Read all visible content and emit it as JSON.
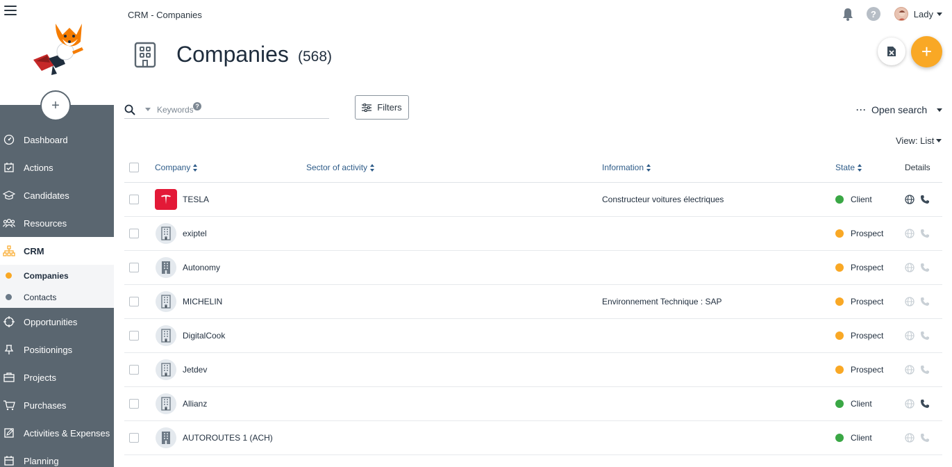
{
  "app": {
    "breadcrumb": "CRM - Companies",
    "user_name": "Lady",
    "help_label": "?"
  },
  "sidebar": {
    "add_label": "+",
    "items": [
      {
        "id": "dashboard",
        "label": "Dashboard",
        "icon": "gauge-icon"
      },
      {
        "id": "actions",
        "label": "Actions",
        "icon": "calendar-check-icon"
      },
      {
        "id": "candidates",
        "label": "Candidates",
        "icon": "graduation-cap-icon"
      },
      {
        "id": "resources",
        "label": "Resources",
        "icon": "users-icon"
      },
      {
        "id": "crm",
        "label": "CRM",
        "icon": "org-chart-icon",
        "active": true
      },
      {
        "id": "opportunities",
        "label": "Opportunities",
        "icon": "crosshair-icon"
      },
      {
        "id": "positionings",
        "label": "Positionings",
        "icon": "pin-icon"
      },
      {
        "id": "projects",
        "label": "Projects",
        "icon": "briefcase-icon"
      },
      {
        "id": "purchases",
        "label": "Purchases",
        "icon": "cart-icon"
      },
      {
        "id": "activities",
        "label": "Activities & Expenses",
        "icon": "edit-icon"
      },
      {
        "id": "planning",
        "label": "Planning",
        "icon": "calendar-icon"
      }
    ],
    "crm_sub": [
      {
        "label": "Companies",
        "active": true,
        "color": "#f9a825"
      },
      {
        "label": "Contacts",
        "active": false,
        "color": "#6b7a88"
      }
    ]
  },
  "page": {
    "title": "Companies",
    "count": "(568)",
    "add_label": "+"
  },
  "search": {
    "placeholder": "Keywords",
    "help": "?",
    "filters_label": "Filters",
    "open_search_label": "Open search",
    "view_label": "View: List"
  },
  "table": {
    "headers": {
      "company": "Company",
      "sector": "Sector of activity",
      "information": "Information",
      "state": "State",
      "details": "Details"
    },
    "rows": [
      {
        "name": "TESLA",
        "sector": "",
        "information": "Constructeur voitures électriques",
        "state": "Client",
        "state_color": "#3aa745",
        "logo": "tesla",
        "web_active": true,
        "phone_active": true
      },
      {
        "name": "exiptel",
        "sector": "",
        "information": "",
        "state": "Prospect",
        "state_color": "#f9a825",
        "logo": "building-outline",
        "web_active": false,
        "phone_active": false
      },
      {
        "name": "Autonomy",
        "sector": "",
        "information": "",
        "state": "Prospect",
        "state_color": "#f9a825",
        "logo": "building-solid",
        "web_active": false,
        "phone_active": false
      },
      {
        "name": "MICHELIN",
        "sector": "",
        "information": "Environnement Technique : SAP",
        "state": "Prospect",
        "state_color": "#f9a825",
        "logo": "building-outline",
        "web_active": false,
        "phone_active": false
      },
      {
        "name": "DigitalCook",
        "sector": "",
        "information": "",
        "state": "Prospect",
        "state_color": "#f9a825",
        "logo": "building-outline",
        "web_active": false,
        "phone_active": false
      },
      {
        "name": "Jetdev",
        "sector": "",
        "information": "",
        "state": "Prospect",
        "state_color": "#f9a825",
        "logo": "building-outline",
        "web_active": false,
        "phone_active": false
      },
      {
        "name": "Allianz",
        "sector": "",
        "information": "",
        "state": "Client",
        "state_color": "#3aa745",
        "logo": "building-outline",
        "web_active": false,
        "phone_active": true
      },
      {
        "name": "AUTOROUTES 1 (ACH)",
        "sector": "",
        "information": "",
        "state": "Client",
        "state_color": "#3aa745",
        "logo": "building-solid",
        "web_active": false,
        "phone_active": false
      }
    ]
  },
  "colors": {
    "accent": "#f9a825",
    "sidebar_bg": "#5a6670",
    "link_blue": "#2d5b88",
    "client_green": "#3aa745",
    "prospect_orange": "#f9a825"
  }
}
